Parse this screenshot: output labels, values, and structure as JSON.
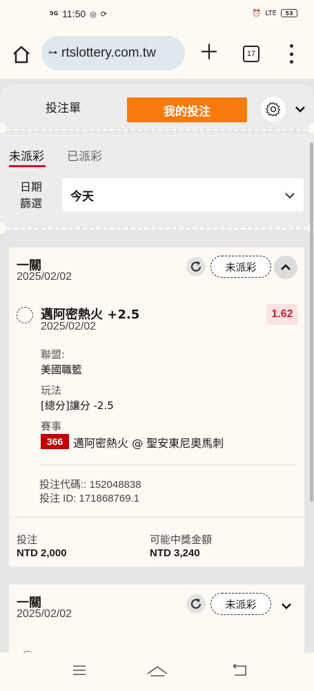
{
  "status_bar": {
    "network": "5G",
    "time": "11:50",
    "icons": [
      "instagram-icon",
      "sync-icon",
      "alarm-icon",
      "volte-icon"
    ],
    "volte": "LTE",
    "battery": "53"
  },
  "browser": {
    "url": "rtslottery.com.tw",
    "tab_count": "17",
    "icons": [
      "home-icon",
      "site-settings-icon",
      "plus-icon",
      "tabs-icon",
      "more-icon"
    ]
  },
  "tabs": {
    "bet_slip": "投注單",
    "my_bets": "我的投注"
  },
  "filter": {
    "tab_unsettled": "未派彩",
    "tab_settled": "已派彩",
    "date_label": "日期 篩選",
    "date_value": "今天"
  },
  "bets": [
    {
      "title": "一關",
      "date": "2025/02/02",
      "status": "未派彩",
      "selection": "邁阿密熱火 +2.5",
      "odds": "1.62",
      "selection_date": "2025/02/02",
      "league_label": "聯盟:",
      "league": "美國職籃",
      "market_label": "玩法",
      "market": "[總分]讓分 -2.5",
      "event_label": "賽事",
      "event_no": "366",
      "event": "邁阿密熱火 @ 聖安東尼奧馬刺",
      "bet_code": "投注代碼:: 152048838",
      "bet_id": "投注 ID: 171868769.1",
      "stake_label": "投注",
      "stake": "NTD 2,000",
      "win_label": "可能中獎金額",
      "win": "NTD 3,240"
    },
    {
      "title": "一關",
      "date": "2025/02/02",
      "status": "未派彩"
    }
  ],
  "colors": {
    "accent": "#f97a0c",
    "tab_underline": "#c8102e",
    "odds_text": "#c0222d",
    "event_badge": "#c00000"
  }
}
